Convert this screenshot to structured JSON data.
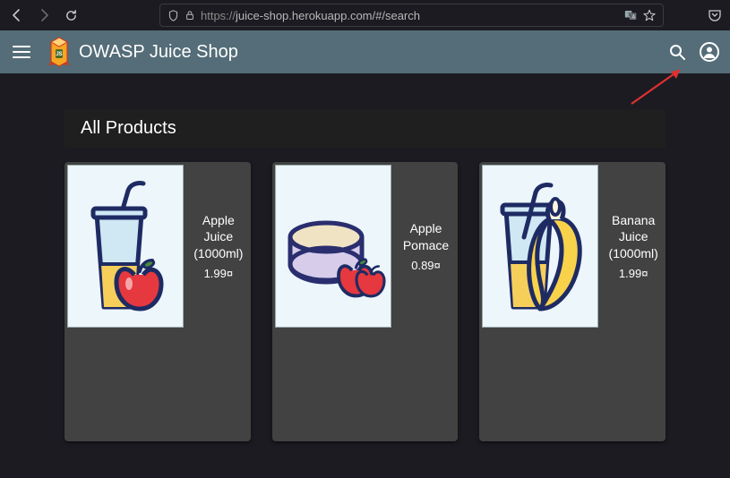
{
  "browser": {
    "url_full": "https://juice-shop.herokuapp.com/#/search",
    "url_host_path": "juice-shop.herokuapp.com/#/search",
    "url_proto": "https://"
  },
  "header": {
    "title": "OWASP Juice Shop"
  },
  "section": {
    "title": "All Products"
  },
  "products": [
    {
      "name": "Apple Juice (1000ml)",
      "price": "1.99¤",
      "icon": "apple-juice"
    },
    {
      "name": "Apple Pomace",
      "price": "0.89¤",
      "icon": "apple-pomace"
    },
    {
      "name": "Banana Juice (1000ml)",
      "price": "1.99¤",
      "icon": "banana-juice"
    }
  ],
  "colors": {
    "header_bg": "#546d78",
    "card_bg": "#424242",
    "page_bg": "#1c1b22",
    "arrow": "#e03030"
  }
}
